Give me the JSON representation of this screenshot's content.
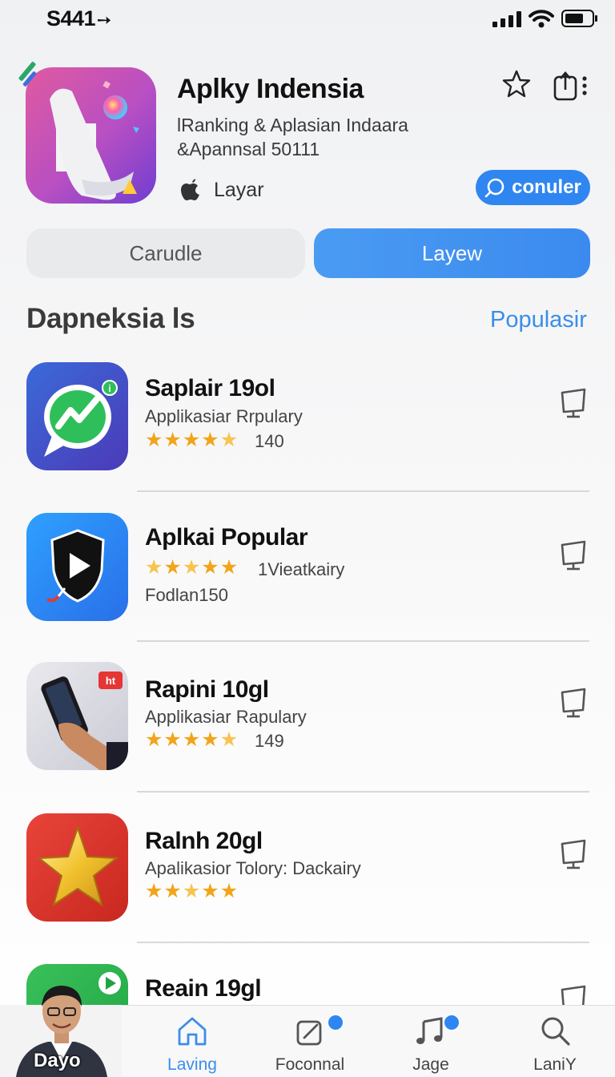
{
  "status_bar": {
    "time": "S441",
    "arrow": "➚"
  },
  "header": {
    "app_title": "Aplky Indensia",
    "subtitle_1": "lRanking & Aplasian Indaara",
    "subtitle_2": "&Apannsal 50111",
    "developer": "Layar",
    "action_button": "conuler"
  },
  "segments": {
    "left": "Carudle",
    "right": "Layew",
    "active": "right"
  },
  "section": {
    "title": "Dapneksia ls",
    "link": "Populasir"
  },
  "apps": [
    {
      "title": "Saplair 19ol",
      "line1": "Applikasiar  Rrpulary",
      "rating": 4.5,
      "count": "140",
      "icon": "chat-chart-icon"
    },
    {
      "title": "Aplkai Popular",
      "line1": "1Vieatkairy",
      "line2": "Fodlan150",
      "rating": 4.5,
      "icon": "shield-play-icon"
    },
    {
      "title": "Rapini 10gl",
      "line1": "Applikasiar  Rapulary",
      "rating": 4.5,
      "count": "149",
      "icon": "phone-in-hand-icon",
      "badge": "ht"
    },
    {
      "title": "Ralnh 20gl",
      "line1": "Apalikasior  Tolory:  Dackairy",
      "rating": 5,
      "icon": "gold-star-icon"
    },
    {
      "title": "Reain 19gl",
      "icon": "green-play-icon"
    }
  ],
  "tab_bar": {
    "profile_label": "Dayo",
    "tabs": [
      {
        "label": "Laving",
        "icon": "home-icon",
        "active": true
      },
      {
        "label": "Foconnal",
        "icon": "edit-icon",
        "active": false
      },
      {
        "label": "Jage",
        "icon": "music-note-icon",
        "active": false
      },
      {
        "label": "LaniY",
        "icon": "search-icon",
        "active": false
      }
    ]
  },
  "colors": {
    "accent": "#2f86f0",
    "link": "#3a8ee8",
    "star": "#f2a41a"
  }
}
